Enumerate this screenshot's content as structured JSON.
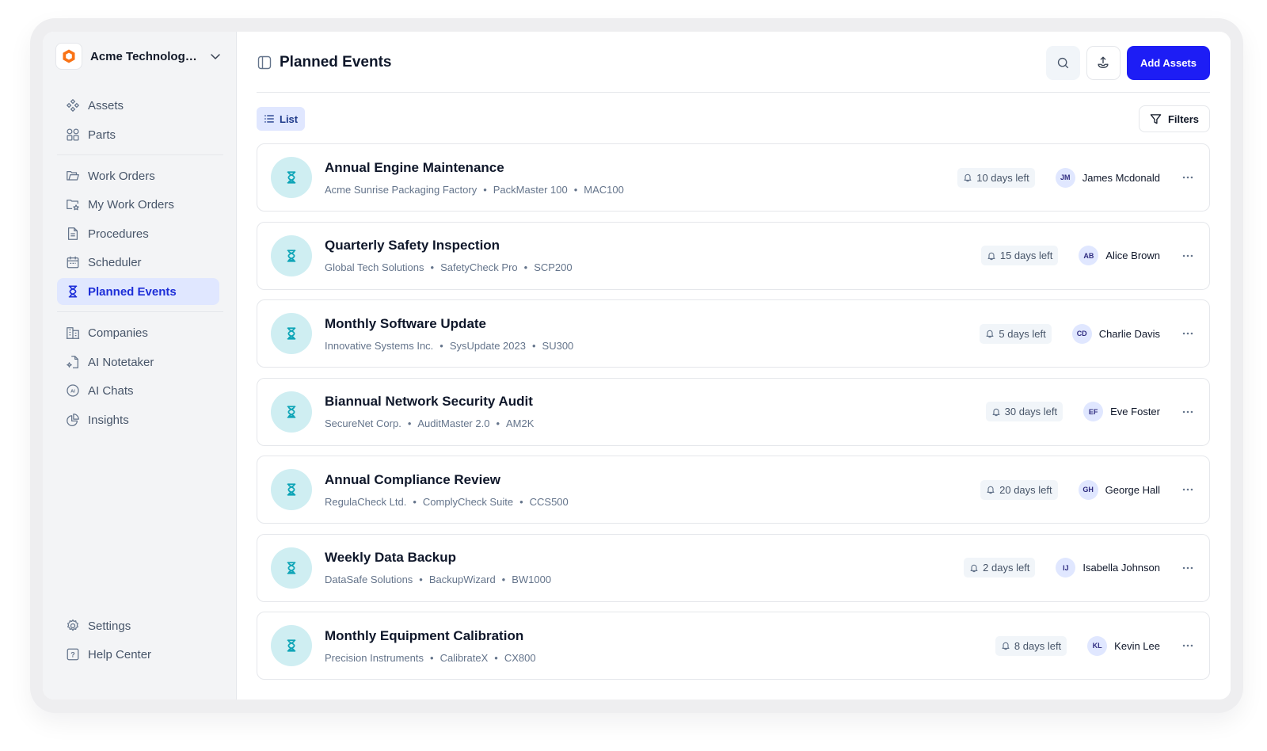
{
  "org": {
    "name": "Acme Technologies"
  },
  "nav": {
    "assets": "Assets",
    "parts": "Parts",
    "work_orders": "Work Orders",
    "my_work_orders": "My Work Orders",
    "procedures": "Procedures",
    "scheduler": "Scheduler",
    "planned_events": "Planned Events",
    "companies": "Companies",
    "ai_notetaker": "AI Notetaker",
    "ai_chats": "AI Chats",
    "insights": "Insights",
    "settings": "Settings",
    "help_center": "Help Center",
    "active": "planned_events"
  },
  "header": {
    "title": "Planned Events",
    "add_button": "Add Assets"
  },
  "toolbar": {
    "view_label": "List",
    "filters_label": "Filters"
  },
  "colors": {
    "accent": "#1d1df5",
    "active_nav_bg": "#e0e7ff",
    "event_icon_bg": "#cfeef2",
    "event_icon_fg": "#0ea5b7"
  },
  "events": [
    {
      "title": "Annual Engine Maintenance",
      "company": "Acme Sunrise Packaging Factory",
      "product": "PackMaster 100",
      "code": "MAC100",
      "due": "10 days left",
      "initials": "JM",
      "assignee": "James Mcdonald"
    },
    {
      "title": "Quarterly Safety Inspection",
      "company": "Global Tech Solutions",
      "product": "SafetyCheck Pro",
      "code": "SCP200",
      "due": "15 days left",
      "initials": "AB",
      "assignee": "Alice Brown"
    },
    {
      "title": "Monthly Software Update",
      "company": "Innovative Systems Inc.",
      "product": "SysUpdate 2023",
      "code": "SU300",
      "due": "5 days left",
      "initials": "CD",
      "assignee": "Charlie Davis"
    },
    {
      "title": "Biannual Network Security Audit",
      "company": "SecureNet Corp.",
      "product": "AuditMaster 2.0",
      "code": "AM2K",
      "due": "30 days left",
      "initials": "EF",
      "assignee": "Eve Foster"
    },
    {
      "title": "Annual Compliance Review",
      "company": "RegulaCheck Ltd.",
      "product": "ComplyCheck Suite",
      "code": "CCS500",
      "due": "20 days left",
      "initials": "GH",
      "assignee": "George Hall"
    },
    {
      "title": "Weekly Data Backup",
      "company": "DataSafe Solutions",
      "product": "BackupWizard",
      "code": "BW1000",
      "due": "2 days left",
      "initials": "IJ",
      "assignee": "Isabella Johnson"
    },
    {
      "title": "Monthly Equipment Calibration",
      "company": "Precision Instruments",
      "product": "CalibrateX",
      "code": "CX800",
      "due": "8 days left",
      "initials": "KL",
      "assignee": "Kevin Lee"
    }
  ]
}
